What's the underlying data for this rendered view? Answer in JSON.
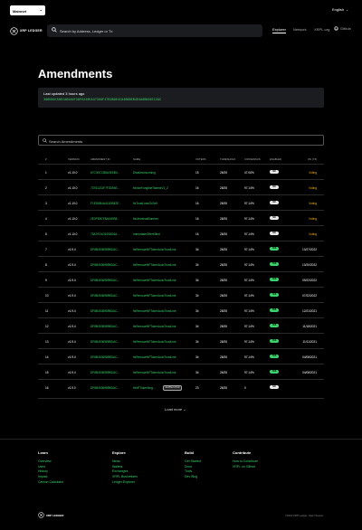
{
  "topbar": {
    "network": "Mainnet",
    "language": "English"
  },
  "header": {
    "logo_text": "XRP LEDGER",
    "search_placeholder": "Search by Address, Ledger or Tx",
    "nav": [
      "Explorer",
      "Network",
      "XRPL.org",
      "Github"
    ]
  },
  "page": {
    "title": "Amendments",
    "last_updated": "Last updated 3 hours ago",
    "ledger_hash": "39B5B6C58ECAB4A6F38F0220EA37369F47B3B9E4C84B6BEB4D4A6B888CC2AC"
  },
  "filter": {
    "placeholder": "Search Amendments"
  },
  "table": {
    "headers": [
      "#",
      "VERSION",
      "AMENDMENT ID",
      "NAME",
      "VOTERS",
      "THRESHOLD",
      "CONSENSUS",
      "ENABLED",
      "ON (TZ)"
    ],
    "rows": [
      {
        "n": "1",
        "v": "v1.10.0",
        "id": "67C30CCB8A3E6B4...",
        "name": "DisallowIncoming",
        "voters": "15",
        "th": "28/35",
        "cons": "47.06%",
        "en": "NO",
        "on": "Voting"
      },
      {
        "n": "2",
        "v": "v1.10.0",
        "id": "73761231F7F3D94E...",
        "name": "fixNonFungibleTokensV1_2",
        "voters": "16",
        "th": "28/35",
        "cons": "97.14%",
        "en": "NO",
        "on": "Voting"
      },
      {
        "n": "3",
        "v": "v1.10.0",
        "id": "F1ED6B4A411DB82E...",
        "name": "fixTrustLinesToSelf",
        "voters": "16",
        "th": "28/35",
        "cons": "97.14%",
        "en": "NO",
        "on": "Voting"
      },
      {
        "n": "4",
        "v": "v1.10.0",
        "id": "2E2FB9CF8A44EB8...",
        "name": "fixUniversalNumber",
        "voters": "16",
        "th": "28/35",
        "cons": "97.14%",
        "en": "NO",
        "on": "Voting"
      },
      {
        "n": "5",
        "v": "v1.10.0",
        "id": "75A7E01C505DD5A...",
        "name": "ImmediateOfferKilled",
        "voters": "16",
        "th": "28/35",
        "cons": "97.14%",
        "en": "NO",
        "on": "Voting"
      },
      {
        "n": "7",
        "v": "v1.9.4",
        "id": "DF8B4536989BDAC...",
        "name": "fixRemoveNFTokenAutoTrustLine",
        "voters": "34",
        "th": "28/35",
        "cons": "97.14%",
        "en": "YES",
        "on": "10/27/2022"
      },
      {
        "n": "8",
        "v": "v1.9.4",
        "id": "DF8B4536989BDAC...",
        "name": "fixRemoveNFTokenAutoTrustLine",
        "voters": "34",
        "th": "28/35",
        "cons": "97.14%",
        "en": "YES",
        "on": "10/20/2022"
      },
      {
        "n": "9",
        "v": "v1.9.4",
        "id": "DF8B4536989BDAC...",
        "name": "fixRemoveNFTokenAutoTrustLine",
        "voters": "34",
        "th": "28/35",
        "cons": "97.14%",
        "en": "YES",
        "on": "09/22/2022"
      },
      {
        "n": "10",
        "v": "v1.9.4",
        "id": "DF8B4536989BDAC...",
        "name": "fixRemoveNFTokenAutoTrustLine",
        "voters": "34",
        "th": "28/35",
        "cons": "97.14%",
        "en": "YES",
        "on": "07/22/2022"
      },
      {
        "n": "11",
        "v": "v1.9.4",
        "id": "DF8B4536989BDAC...",
        "name": "fixRemoveNFTokenAutoTrustLine",
        "voters": "34",
        "th": "28/35",
        "cons": "97.14%",
        "en": "YES",
        "on": "12/21/2021"
      },
      {
        "n": "12",
        "v": "v1.9.4",
        "id": "DF8B4536989BDAC...",
        "name": "fixRemoveNFTokenAutoTrustLine",
        "voters": "34",
        "th": "28/35",
        "cons": "97.14%",
        "en": "YES",
        "on": "11/18/2021"
      },
      {
        "n": "13",
        "v": "v1.9.4",
        "id": "DF8B4536989BDAC...",
        "name": "fixRemoveNFTokenAutoTrustLine",
        "voters": "34",
        "th": "28/35",
        "cons": "97.14%",
        "en": "YES",
        "on": "11/11/2021"
      },
      {
        "n": "14",
        "v": "v1.9.4",
        "id": "DF8B4536989BDAC...",
        "name": "fixRemoveNFTokenAutoTrustLine",
        "voters": "34",
        "th": "28/35",
        "cons": "97.14%",
        "en": "YES",
        "on": "04/08/2021"
      },
      {
        "n": "15",
        "v": "v1.9.4",
        "id": "DF8B4536989BDAC...",
        "name": "fixRemoveNFTokenAutoTrustLine",
        "voters": "34",
        "th": "28/35",
        "cons": "97.14%",
        "en": "YES",
        "on": "04/08/2021"
      },
      {
        "n": "16",
        "v": "v1.9.0",
        "id": "DF8B4536989BDAC...",
        "name": "fixNFTokenNeg...",
        "voters": "23",
        "th": "28/35",
        "cons": "0",
        "en": "NO",
        "on": "",
        "deprecated": "DEPRECATED"
      }
    ]
  },
  "load_more": "Load more",
  "footer": {
    "columns": [
      {
        "heading": "Learn",
        "links": [
          "Overview",
          "Uses",
          "History",
          "Impact",
          "Carbon Calculator"
        ]
      },
      {
        "heading": "Explore",
        "links": [
          "News",
          "Wallets",
          "Exchanges",
          "XRPL Businesses",
          "Ledger Explorer"
        ]
      },
      {
        "heading": "Build",
        "links": [
          "Get Started",
          "Docs",
          "Tools",
          "Dev Blog"
        ]
      },
      {
        "heading": "Contribute",
        "links": [
          "How to Contribute",
          "XRPL on Github"
        ]
      }
    ],
    "logo_text": "XRP LEDGER",
    "copyright": "©2022 XRP Ledger. Open Source."
  },
  "colors": {
    "accent_green": "#3bd36a",
    "voting_yellow": "#f2b01d",
    "panel": "#1b1c1f"
  }
}
